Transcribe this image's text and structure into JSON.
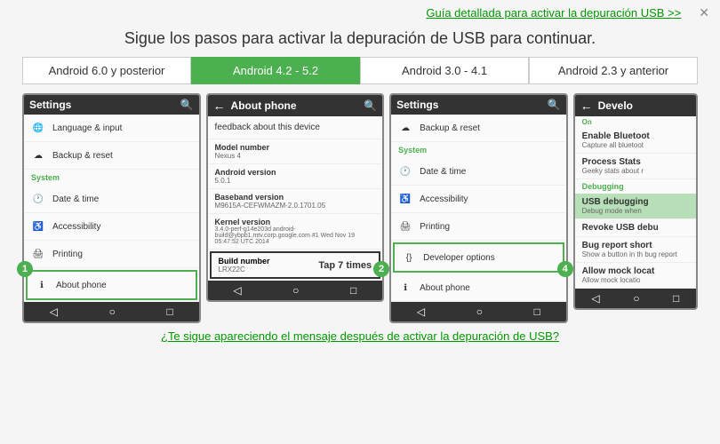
{
  "header": {
    "guide_link": "Guía detallada para activar la depuración USB >>",
    "close_label": "✕",
    "main_title": "Sigue los pasos para activar la depuración de USB para continuar."
  },
  "tabs": [
    {
      "label": "Android 6.0 y posterior",
      "active": false
    },
    {
      "label": "Android 4.2 - 5.2",
      "active": true
    },
    {
      "label": "Android 3.0 - 4.1",
      "active": false
    },
    {
      "label": "Android 2.3 y anterior",
      "active": false
    }
  ],
  "screen1": {
    "title": "Settings",
    "items": [
      {
        "icon": "🌐",
        "label": "Language & input"
      },
      {
        "icon": "☁",
        "label": "Backup & reset"
      }
    ],
    "section": "System",
    "system_items": [
      {
        "icon": "🕐",
        "label": "Date & time"
      },
      {
        "icon": "♿",
        "label": "Accessibility"
      },
      {
        "icon": "🖨",
        "label": "Printing"
      },
      {
        "icon": "ℹ",
        "label": "About phone",
        "highlighted": true
      }
    ],
    "step": "1"
  },
  "screen2": {
    "title": "About phone",
    "feedback": "feedback about this device",
    "fields": [
      {
        "label": "Model number",
        "value": "Nexus 4"
      },
      {
        "label": "Android version",
        "value": "5.0.1"
      },
      {
        "label": "Baseband version",
        "value": "M9615A-CEFWMAZM-2.0.1701.05"
      },
      {
        "label": "Kernel version",
        "value": "3.4.0-perf-g14e203d\nandroid-build@ybpb1.mtv.corp.google.com #1\nWed Nov 19 05:47:52 UTC 2014"
      }
    ],
    "build_label": "Build number",
    "build_value": "LRX22C",
    "tap_text": "Tap 7 times",
    "step": "2"
  },
  "screen3": {
    "title": "Settings",
    "items": [
      {
        "icon": "☁",
        "label": "Backup & reset"
      }
    ],
    "section": "System",
    "system_items": [
      {
        "icon": "🕐",
        "label": "Date & time"
      },
      {
        "icon": "♿",
        "label": "Accessibility"
      },
      {
        "icon": "🖨",
        "label": "Printing"
      },
      {
        "icon": "{}",
        "label": "Developer options",
        "highlighted": true
      },
      {
        "icon": "ℹ",
        "label": "About phone"
      }
    ],
    "step": "4"
  },
  "screen4": {
    "title": "Develo",
    "toggle": "On",
    "items": [
      {
        "title": "Enable Bluetoot",
        "sub": "Capture all bluetoot",
        "highlighted": false
      },
      {
        "title": "Process Stats",
        "sub": "Geeky stats about r",
        "highlighted": false
      }
    ],
    "debug_section": "Debugging",
    "debug_items": [
      {
        "title": "USB debugging",
        "sub": "Debug mode when",
        "highlighted": true
      },
      {
        "title": "Revoke USB debu",
        "sub": "",
        "highlighted": false
      },
      {
        "title": "Bug report short",
        "sub": "Show a button in th\nbug report",
        "highlighted": false
      },
      {
        "title": "Allow mock locat",
        "sub": "Allow mock locatio",
        "highlighted": false
      }
    ]
  },
  "bottom_link": "¿Te sigue apareciendo el mensaje después de activar la depuración de USB?"
}
